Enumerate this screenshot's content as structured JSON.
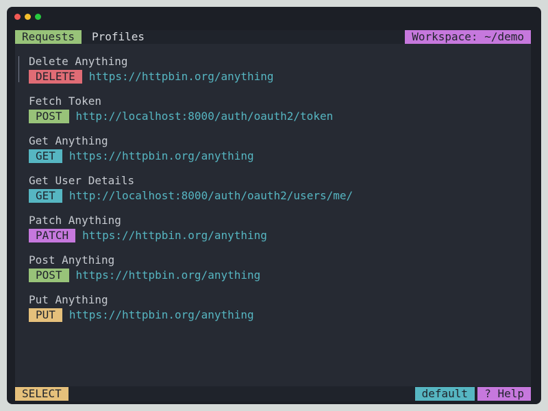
{
  "window": {
    "controls": [
      "close",
      "minimize",
      "maximize"
    ]
  },
  "topbar": {
    "tabs": [
      {
        "label": "Requests",
        "active": true
      },
      {
        "label": "Profiles",
        "active": false
      }
    ],
    "workspace_label": "Workspace: ~/demo"
  },
  "requests": [
    {
      "name": "Delete Anything",
      "method": "DELETE",
      "url": "https://httpbin.org/anything",
      "selected": true
    },
    {
      "name": "Fetch Token",
      "method": "POST",
      "url": "http://localhost:8000/auth/oauth2/token",
      "selected": false
    },
    {
      "name": "Get Anything",
      "method": "GET",
      "url": "https://httpbin.org/anything",
      "selected": false
    },
    {
      "name": "Get User Details",
      "method": "GET",
      "url": "http://localhost:8000/auth/oauth2/users/me/",
      "selected": false
    },
    {
      "name": "Patch Anything",
      "method": "PATCH",
      "url": "https://httpbin.org/anything",
      "selected": false
    },
    {
      "name": "Post Anything",
      "method": "POST",
      "url": "https://httpbin.org/anything",
      "selected": false
    },
    {
      "name": "Put Anything",
      "method": "PUT",
      "url": "https://httpbin.org/anything",
      "selected": false
    }
  ],
  "statusbar": {
    "mode": "SELECT",
    "profile": "default",
    "help": "? Help"
  },
  "colors": {
    "DELETE": "#e06c75",
    "POST": "#98c379",
    "GET": "#56b6c2",
    "PATCH": "#c678dd",
    "PUT": "#e5c07b",
    "url": "#56b6c2",
    "background": "#262a33"
  }
}
